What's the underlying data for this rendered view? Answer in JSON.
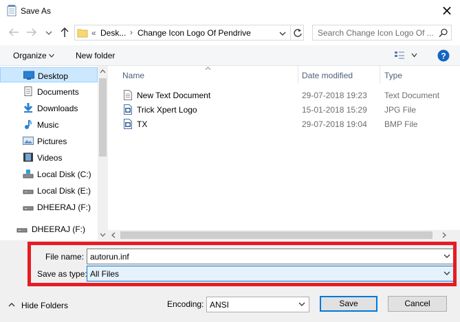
{
  "window": {
    "title": "Save As",
    "close_glyph": "×"
  },
  "nav": {
    "back_icon": "arrow-left-icon",
    "forward_icon": "arrow-right-icon",
    "recent_icon": "chevron-down-icon",
    "up_icon": "arrow-up-icon"
  },
  "address": {
    "overflow": "«",
    "crumbs": [
      "Desk...",
      "Change Icon Logo Of Pendrive"
    ],
    "separator": "›"
  },
  "search": {
    "placeholder": "Search Change Icon Logo Of ..."
  },
  "toolbar": {
    "organize_label": "Organize",
    "new_folder_label": "New folder"
  },
  "sidebar": {
    "items": [
      {
        "label": "Desktop",
        "icon": "desktop-icon",
        "selected": true
      },
      {
        "label": "Documents",
        "icon": "documents-icon"
      },
      {
        "label": "Downloads",
        "icon": "downloads-icon"
      },
      {
        "label": "Music",
        "icon": "music-icon"
      },
      {
        "label": "Pictures",
        "icon": "pictures-icon"
      },
      {
        "label": "Videos",
        "icon": "videos-icon"
      },
      {
        "label": "Local Disk (C:)",
        "icon": "drive-c-icon"
      },
      {
        "label": "Local Disk (E:)",
        "icon": "drive-icon"
      },
      {
        "label": "DHEERAJ (F:)",
        "icon": "usb-drive-icon"
      }
    ],
    "extra_item": {
      "label": "DHEERAJ (F:)",
      "icon": "usb-drive-icon"
    }
  },
  "columns": {
    "name": "Name",
    "date": "Date modified",
    "type": "Type"
  },
  "files": [
    {
      "name": "New Text Document",
      "date": "29-07-2018 19:23",
      "type": "Text Document",
      "icon": "text-file-icon"
    },
    {
      "name": "Trick Xpert Logo",
      "date": "15-01-2018 15:29",
      "type": "JPG File",
      "icon": "image-file-icon"
    },
    {
      "name": "TX",
      "date": "29-07-2018 19:04",
      "type": "BMP File",
      "icon": "image-file-icon"
    }
  ],
  "form": {
    "file_name_label": "File name:",
    "file_name_value": "autorun.inf",
    "save_type_label": "Save as type:",
    "save_type_value": "All Files"
  },
  "footer": {
    "hide_folders_label": "Hide Folders",
    "encoding_label": "Encoding:",
    "encoding_value": "ANSI",
    "save_label": "Save",
    "cancel_label": "Cancel"
  },
  "colors": {
    "highlight_border": "#e51c23",
    "selection_bg": "#cce8ff",
    "help_blue": "#1565c0"
  }
}
